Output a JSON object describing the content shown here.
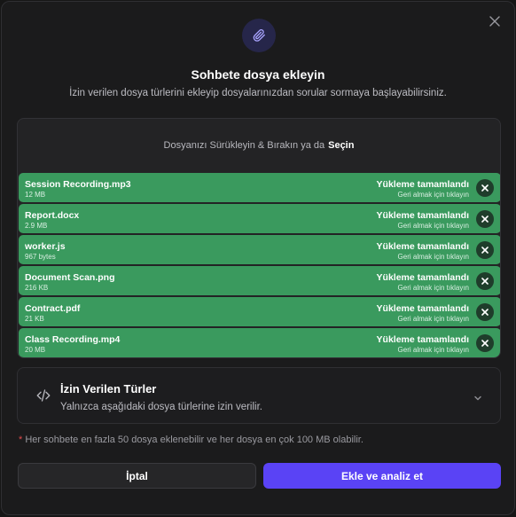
{
  "header": {
    "icon": "paperclip-icon",
    "title": "Sohbete dosya ekleyin",
    "subtitle": "İzin verilen dosya türlerini ekleyip dosyalarınızdan sorular sormaya başlayabilirsiniz."
  },
  "dropzone": {
    "prompt": "Dosyanızı Sürükleyin & Bırakın ya da",
    "browse_label": "Seçin"
  },
  "files": [
    {
      "name": "Session Recording.mp3",
      "size": "12 MB",
      "status": "Yükleme tamamlandı",
      "undo": "Geri almak için tıklayın"
    },
    {
      "name": "Report.docx",
      "size": "2.9 MB",
      "status": "Yükleme tamamlandı",
      "undo": "Geri almak için tıklayın"
    },
    {
      "name": "worker.js",
      "size": "967 bytes",
      "status": "Yükleme tamamlandı",
      "undo": "Geri almak için tıklayın"
    },
    {
      "name": "Document Scan.png",
      "size": "216 KB",
      "status": "Yükleme tamamlandı",
      "undo": "Geri almak için tıklayın"
    },
    {
      "name": "Contract.pdf",
      "size": "21 KB",
      "status": "Yükleme tamamlandı",
      "undo": "Geri almak için tıklayın"
    },
    {
      "name": "Class Recording.mp4",
      "size": "20 MB",
      "status": "Yükleme tamamlandı",
      "undo": "Geri almak için tıklayın"
    }
  ],
  "allowed_types": {
    "icon": "code-icon",
    "title": "İzin Verilen Türler",
    "description": "Yalnızca aşağıdaki dosya türlerine izin verilir."
  },
  "note": {
    "marker": "*",
    "text": "Her sohbete en fazla 50 dosya eklenebilir ve her dosya en çok 100 MB olabilir."
  },
  "buttons": {
    "cancel": "İptal",
    "submit": "Ekle ve analiz et"
  },
  "colors": {
    "accent": "#5a43f5",
    "success": "#3a9a5e",
    "background": "#1b1b1c"
  }
}
